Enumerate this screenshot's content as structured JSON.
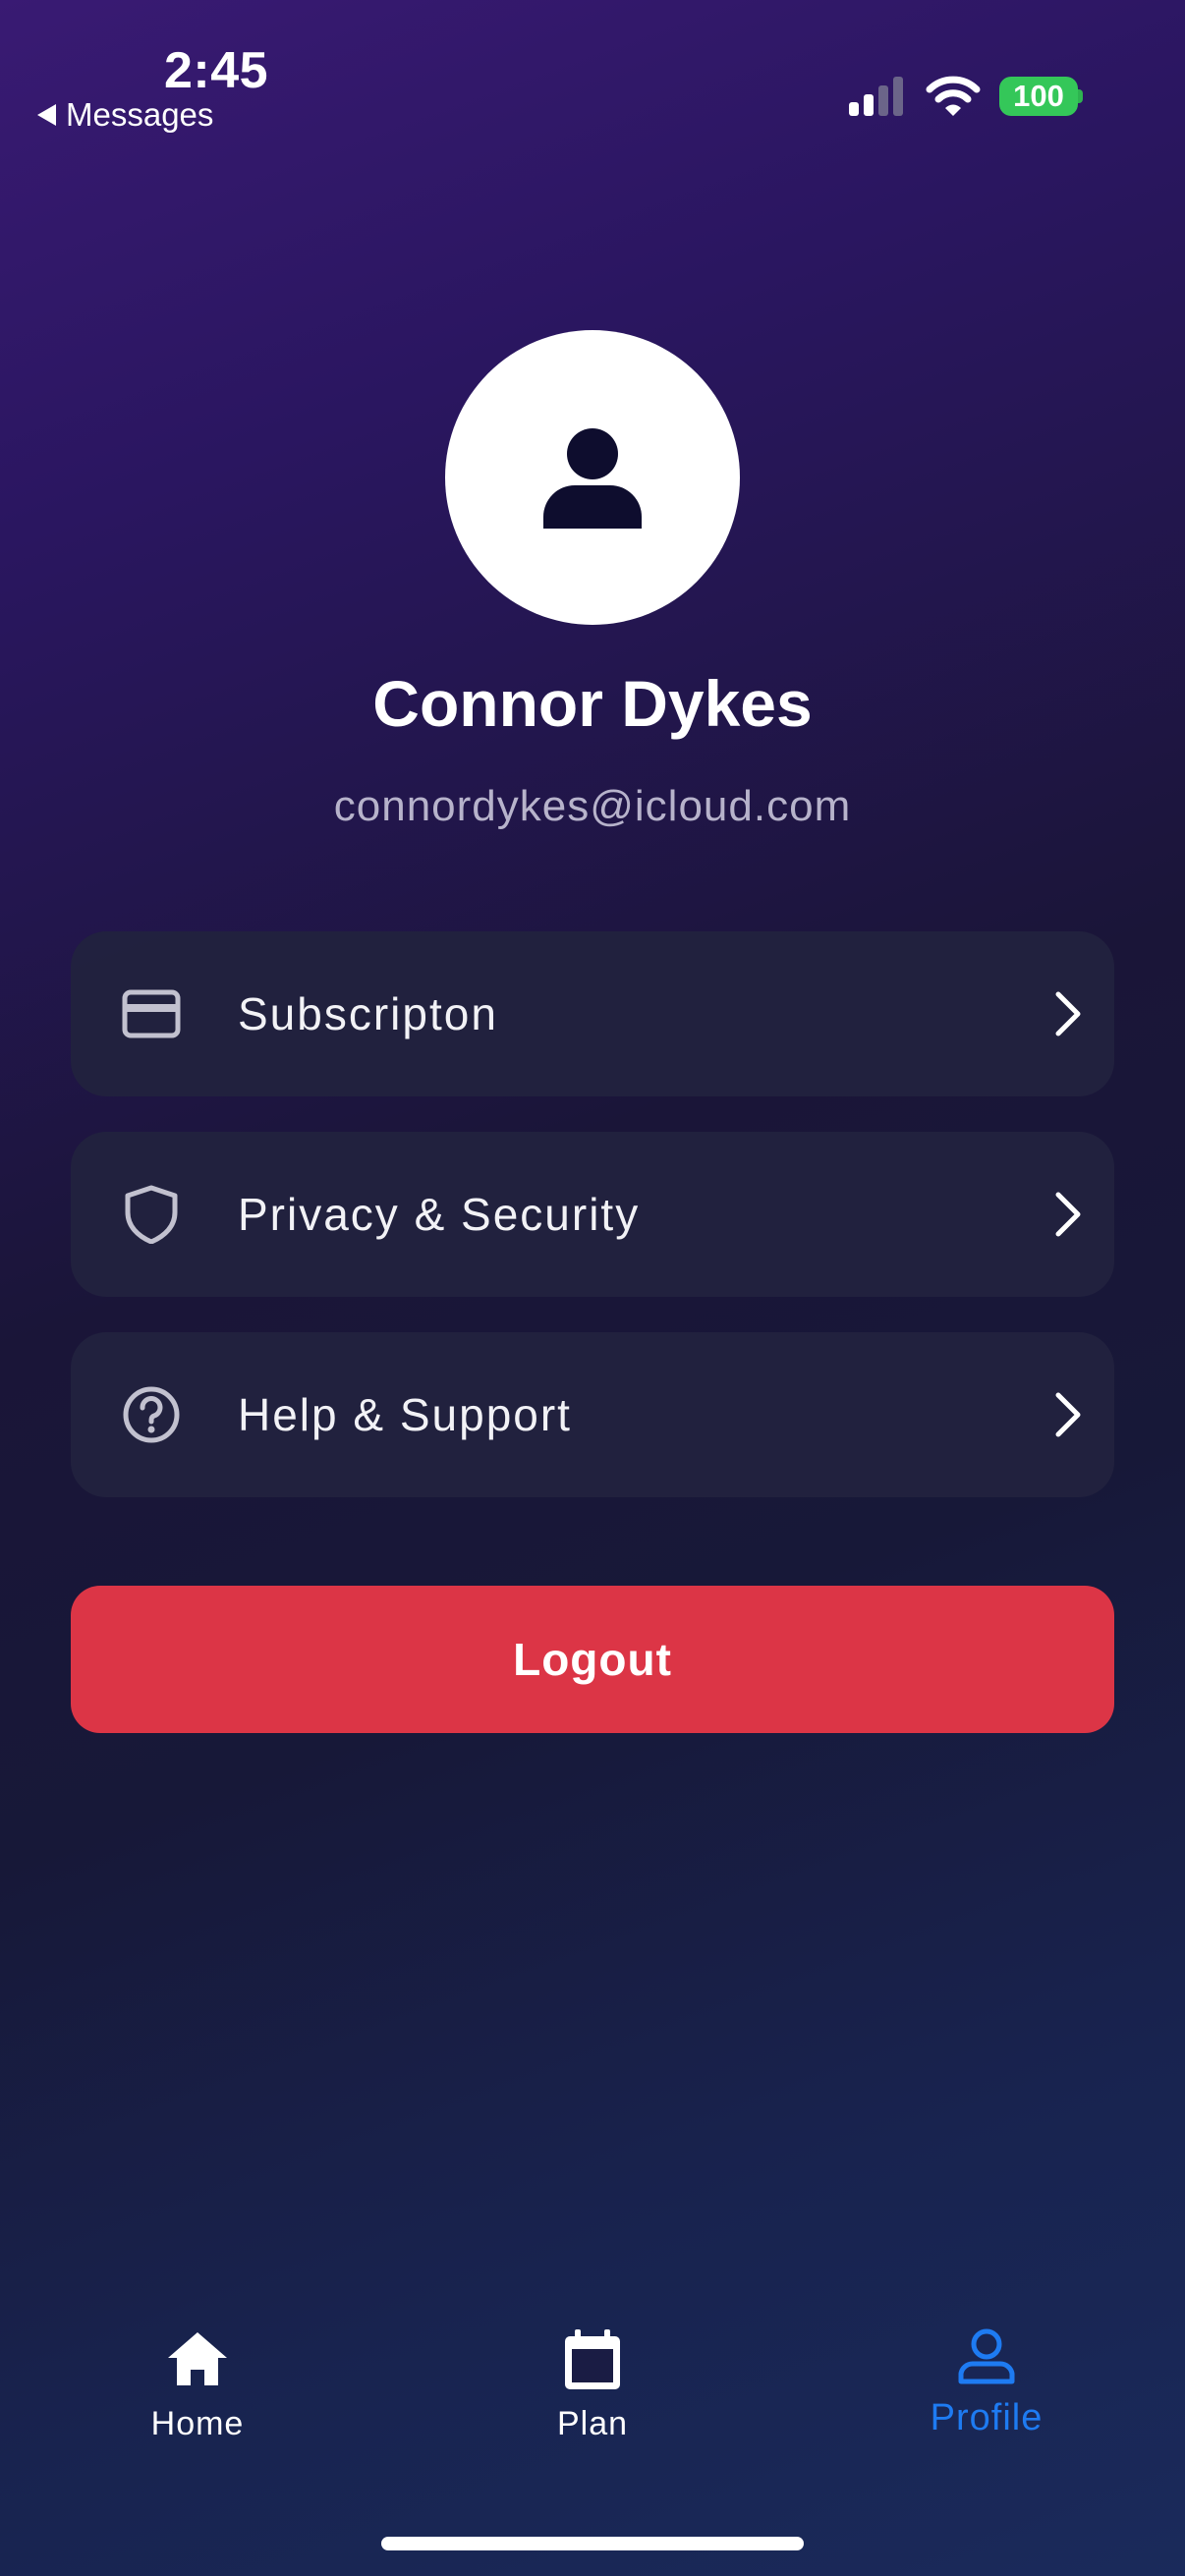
{
  "status_bar": {
    "time": "2:45",
    "back_app": "Messages",
    "battery": "100",
    "signal_icon": "cellular-signal-icon",
    "wifi_icon": "wifi-icon"
  },
  "profile": {
    "avatar_icon": "person-icon",
    "name": "Connor Dykes",
    "email": "connordykes@icloud.com"
  },
  "menu": {
    "items": [
      {
        "icon": "credit-card-icon",
        "label": "Subscripton"
      },
      {
        "icon": "shield-icon",
        "label": "Privacy & Security"
      },
      {
        "icon": "help-circle-icon",
        "label": "Help & Support"
      }
    ]
  },
  "logout_label": "Logout",
  "tab_bar": {
    "tabs": [
      {
        "icon": "home-icon",
        "label": "Home",
        "active": false
      },
      {
        "icon": "calendar-icon",
        "label": "Plan",
        "active": false
      },
      {
        "icon": "profile-icon",
        "label": "Profile",
        "active": true
      }
    ]
  },
  "colors": {
    "accent": "#1e7bf2",
    "logout": "#dc3546",
    "battery": "#34c759",
    "card": "#22223e"
  }
}
